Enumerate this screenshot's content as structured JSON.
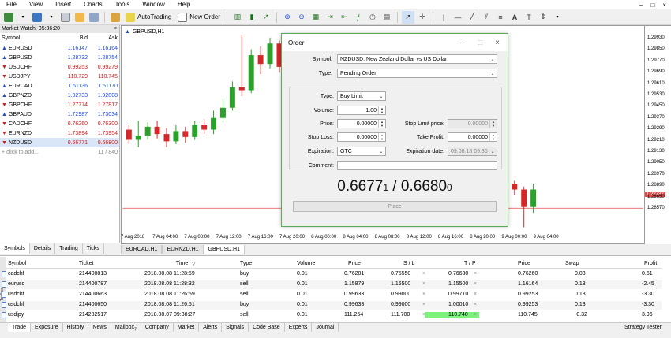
{
  "menu": [
    "File",
    "View",
    "Insert",
    "Charts",
    "Tools",
    "Window",
    "Help"
  ],
  "window_controls": [
    "–",
    "□",
    "×"
  ],
  "toolbar": {
    "autotrading": "AutoTrading",
    "new_order": "New Order"
  },
  "market_watch": {
    "title": "Market Watch: 05:36:20",
    "headers": {
      "symbol": "Symbol",
      "bid": "Bid",
      "ask": "Ask"
    },
    "rows": [
      {
        "symbol": "EURUSD",
        "bid": "1.16147",
        "ask": "1.16164",
        "dir": "up"
      },
      {
        "symbol": "GBPUSD",
        "bid": "1.28732",
        "ask": "1.28754",
        "dir": "up"
      },
      {
        "symbol": "USDCHF",
        "bid": "0.99253",
        "ask": "0.99279",
        "dir": "down"
      },
      {
        "symbol": "USDJPY",
        "bid": "110.729",
        "ask": "110.745",
        "dir": "down"
      },
      {
        "symbol": "EURCAD",
        "bid": "1.51136",
        "ask": "1.51170",
        "dir": "up"
      },
      {
        "symbol": "GBPNZD",
        "bid": "1.92733",
        "ask": "1.92808",
        "dir": "up"
      },
      {
        "symbol": "GBPCHF",
        "bid": "1.27774",
        "ask": "1.27817",
        "dir": "down"
      },
      {
        "symbol": "GBPAUD",
        "bid": "1.72987",
        "ask": "1.73034",
        "dir": "up"
      },
      {
        "symbol": "CADCHF",
        "bid": "0.76260",
        "ask": "0.76300",
        "dir": "down"
      },
      {
        "symbol": "EURNZD",
        "bid": "1.73894",
        "ask": "1.73954",
        "dir": "down"
      },
      {
        "symbol": "NZDUSD",
        "bid": "0.66771",
        "ask": "0.66800",
        "dir": "down"
      }
    ],
    "click_to_add": "click to add...",
    "count": "11 / 840",
    "tabs": [
      "Symbols",
      "Details",
      "Trading",
      "Ticks"
    ]
  },
  "chart": {
    "title": "GBPUSD,H1",
    "price_labels": [
      "1.29930",
      "1.29850",
      "1.29770",
      "1.29690",
      "1.29610",
      "1.29530",
      "1.29450",
      "1.29370",
      "1.29290",
      "1.29210",
      "1.29130",
      "1.29050",
      "1.28970",
      "1.28890",
      "1.28732",
      "1.28650",
      "1.28570"
    ],
    "time_labels": [
      "7 Aug 2018",
      "7 Aug 04:00",
      "7 Aug 08:00",
      "7 Aug 12:00",
      "7 Aug 16:00",
      "7 Aug 20:00",
      "8 Aug 00:00",
      "8 Aug 04:00",
      "8 Aug 08:00",
      "8 Aug 12:00",
      "8 Aug 16:00",
      "8 Aug 20:00",
      "9 Aug 00:00",
      "9 Aug 04:00"
    ],
    "current_price": "1.28732",
    "tabs": [
      "EURCAD,H1",
      "EURNZD,H1",
      "GBPUSD,H1"
    ]
  },
  "chart_data": {
    "type": "candlestick",
    "title": "GBPUSD,H1",
    "candles": [
      {
        "o": 1.2927,
        "c": 1.292,
        "h": 1.293,
        "l": 1.2917
      },
      {
        "o": 1.292,
        "c": 1.2923,
        "h": 1.2933,
        "l": 1.2915
      },
      {
        "o": 1.2923,
        "c": 1.2929,
        "h": 1.2932,
        "l": 1.292
      },
      {
        "o": 1.2929,
        "c": 1.2924,
        "h": 1.2933,
        "l": 1.2921
      },
      {
        "o": 1.2924,
        "c": 1.2919,
        "h": 1.2928,
        "l": 1.2915
      },
      {
        "o": 1.2919,
        "c": 1.2926,
        "h": 1.293,
        "l": 1.2917
      },
      {
        "o": 1.2926,
        "c": 1.2922,
        "h": 1.2929,
        "l": 1.2918
      },
      {
        "o": 1.2922,
        "c": 1.293,
        "h": 1.2933,
        "l": 1.292
      },
      {
        "o": 1.293,
        "c": 1.2927,
        "h": 1.2934,
        "l": 1.2924
      },
      {
        "o": 1.2927,
        "c": 1.2935,
        "h": 1.294,
        "l": 1.2924
      },
      {
        "o": 1.2935,
        "c": 1.2942,
        "h": 1.2948,
        "l": 1.2932
      },
      {
        "o": 1.2942,
        "c": 1.2956,
        "h": 1.296,
        "l": 1.294
      },
      {
        "o": 1.2956,
        "c": 1.2954,
        "h": 1.2992,
        "l": 1.295
      },
      {
        "o": 1.2954,
        "c": 1.2978,
        "h": 1.2982,
        "l": 1.2952
      },
      {
        "o": 1.2978,
        "c": 1.2972,
        "h": 1.2984,
        "l": 1.2965
      },
      {
        "o": 1.2972,
        "c": 1.2986,
        "h": 1.299,
        "l": 1.2969
      },
      {
        "o": 1.2986,
        "c": 1.297,
        "h": 1.2988,
        "l": 1.2966
      },
      {
        "o": 1.297,
        "c": 1.296,
        "h": 1.2974,
        "l": 1.2956
      },
      {
        "o": 1.296,
        "c": 1.2968,
        "h": 1.2972,
        "l": 1.2957
      },
      {
        "o": 1.2968,
        "c": 1.2962,
        "h": 1.297,
        "l": 1.2958
      },
      {
        "o": 1.2962,
        "c": 1.2966,
        "h": 1.297,
        "l": 1.296
      },
      {
        "o": 1.2966,
        "c": 1.2965,
        "h": 1.2969,
        "l": 1.2961
      },
      {
        "o": 1.2965,
        "c": 1.2976,
        "h": 1.298,
        "l": 1.2962
      },
      {
        "o": 1.2976,
        "c": 1.2966,
        "h": 1.2979,
        "l": 1.2962
      },
      {
        "o": 1.2966,
        "c": 1.295,
        "h": 1.2968,
        "l": 1.294
      },
      {
        "o": 1.295,
        "c": 1.296,
        "h": 1.2964,
        "l": 1.2947
      },
      {
        "o": 1.296,
        "c": 1.2968,
        "h": 1.2972,
        "l": 1.2958
      },
      {
        "o": 1.2968,
        "c": 1.2962,
        "h": 1.2971,
        "l": 1.296
      },
      {
        "o": 1.2962,
        "c": 1.2948,
        "h": 1.2964,
        "l": 1.2946
      },
      {
        "o": 1.2948,
        "c": 1.296,
        "h": 1.2964,
        "l": 1.2946
      },
      {
        "o": 1.296,
        "c": 1.2954,
        "h": 1.2962,
        "l": 1.2948
      },
      {
        "o": 1.2954,
        "c": 1.2954,
        "h": 1.2956,
        "l": 1.2945
      },
      {
        "o": 1.2954,
        "c": 1.2952,
        "h": 1.2956,
        "l": 1.2945
      },
      {
        "o": 1.2952,
        "c": 1.2959,
        "h": 1.296,
        "l": 1.2948
      },
      {
        "o": 1.2959,
        "c": 1.2936,
        "h": 1.2962,
        "l": 1.293
      },
      {
        "o": 1.2936,
        "c": 1.2932,
        "h": 1.294,
        "l": 1.2929
      },
      {
        "o": 1.293,
        "c": 1.2922,
        "h": 1.2934,
        "l": 1.2918
      },
      {
        "o": 1.2922,
        "c": 1.291,
        "h": 1.2925,
        "l": 1.2906
      },
      {
        "o": 1.291,
        "c": 1.2906,
        "h": 1.2918,
        "l": 1.2902
      },
      {
        "o": 1.2906,
        "c": 1.2898,
        "h": 1.291,
        "l": 1.2895
      },
      {
        "o": 1.2898,
        "c": 1.289,
        "h": 1.2902,
        "l": 1.2886
      },
      {
        "o": 1.289,
        "c": 1.2886,
        "h": 1.2892,
        "l": 1.2882
      },
      {
        "o": 1.2886,
        "c": 1.2874,
        "h": 1.2888,
        "l": 1.286
      },
      {
        "o": 1.2874,
        "c": 1.2886,
        "h": 1.289,
        "l": 1.287
      }
    ]
  },
  "order": {
    "title": "Order",
    "symbol_label": "Symbol:",
    "symbol_value": "NZDUSD, New Zealand Dollar vs US Dollar",
    "type_label": "Type:",
    "type_value": "Pending Order",
    "sub_type_label": "Type:",
    "sub_type_value": "Buy Limit",
    "volume_label": "Volume:",
    "volume_value": "1.00",
    "price_label": "Price:",
    "price_value": "0.00000",
    "stop_limit_label": "Stop Limit price:",
    "stop_limit_value": "0.00000",
    "stop_loss_label": "Stop Loss:",
    "stop_loss_value": "0.00000",
    "take_profit_label": "Take Profit:",
    "take_profit_value": "0.00000",
    "expiration_label": "Expiration:",
    "expiration_value": "GTC",
    "exp_date_label": "Expiration date:",
    "exp_date_value": "09.08.18 09:36",
    "comment_label": "Comment:",
    "comment_value": "",
    "bid_big": "0.6677",
    "bid_small": "1",
    "separator": " / ",
    "ask_big": "0.6680",
    "ask_small": "0",
    "place_button": "Place"
  },
  "trades": {
    "headers": [
      "Symbol",
      "Ticket",
      "Time",
      "Type",
      "Volume",
      "Price",
      "S / L",
      "T / P",
      "Price",
      "Swap",
      "Profit"
    ],
    "sort_indicator": "▽",
    "rows": [
      {
        "symbol": "cadchf",
        "ticket": "214400813",
        "time": "2018.08.08 11:28:59",
        "type": "buy",
        "volume": "0.01",
        "price": "0.76201",
        "sl": "0.75550",
        "tp": "0.76630",
        "cur": "0.76260",
        "swap": "0.03",
        "profit": "0.51"
      },
      {
        "symbol": "eurusd",
        "ticket": "214400787",
        "time": "2018.08.08 11:28:32",
        "type": "sell",
        "volume": "0.01",
        "price": "1.15879",
        "sl": "1.16500",
        "tp": "1.15500",
        "cur": "1.16164",
        "swap": "0.13",
        "profit": "-2.45"
      },
      {
        "symbol": "usdchf",
        "ticket": "214400663",
        "time": "2018.08.08 11:26:59",
        "type": "sell",
        "volume": "0.01",
        "price": "0.99633",
        "sl": "0.99000",
        "tp": "0.99710",
        "cur": "0.99253",
        "swap": "0.13",
        "profit": "-3.30"
      },
      {
        "symbol": "usdchf",
        "ticket": "214400650",
        "time": "2018.08.08 11:26:51",
        "type": "buy",
        "volume": "0.01",
        "price": "0.99633",
        "sl": "0.99000",
        "tp": "1.00010",
        "cur": "0.99253",
        "swap": "0.13",
        "profit": "-3.30"
      },
      {
        "symbol": "usdjpy",
        "ticket": "214282517",
        "time": "2018.08.07 09:38:27",
        "type": "sell",
        "volume": "0.01",
        "price": "111.254",
        "sl": "111.700",
        "tp": "110.740",
        "cur": "110.745",
        "swap": "-0.32",
        "profit": "3.96"
      }
    ],
    "tp_highlight_color": "#7cf27c",
    "tabs": [
      "Trade",
      "Exposure",
      "History",
      "News",
      "Mailbox",
      "Company",
      "Market",
      "Alerts",
      "Signals",
      "Code Base",
      "Experts",
      "Journal"
    ],
    "mailbox_badge": "7",
    "strategy_tester": "Strategy Tester",
    "toolbox_label": "Toolbox"
  },
  "colors": {
    "bull": "#2ca02c",
    "bear": "#d62728",
    "price_line": "#e04a4a",
    "accent": "#1f49d6"
  }
}
